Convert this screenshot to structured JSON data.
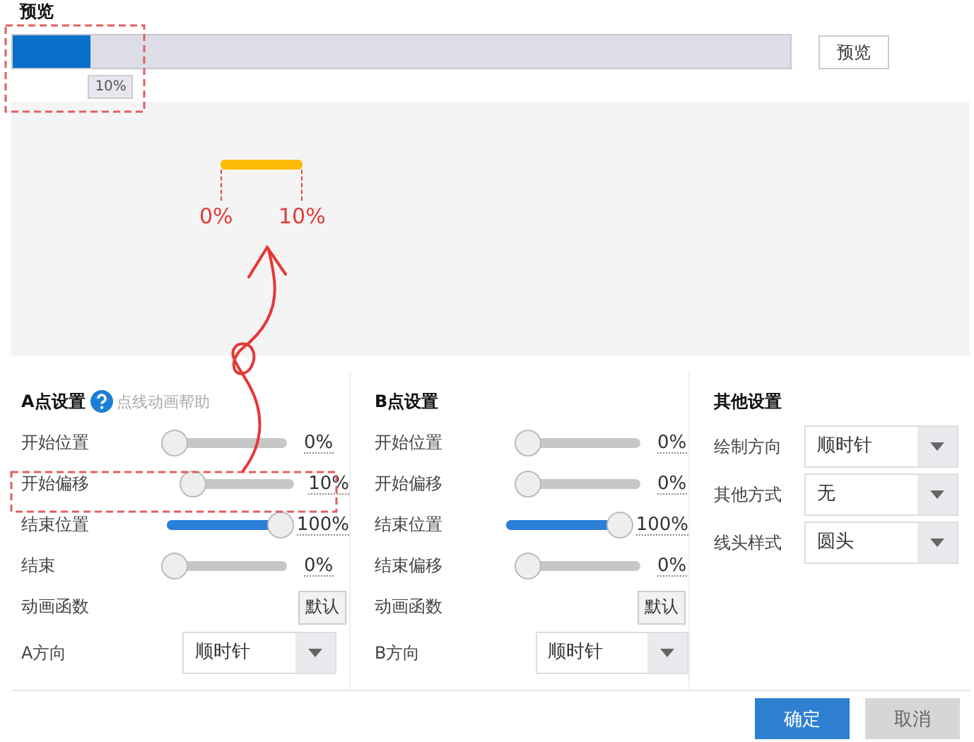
{
  "preview": {
    "title": "预览",
    "progress": {
      "level": 0.1,
      "tooltip": "10%"
    },
    "button": "预览"
  },
  "canvas": {
    "labels": [
      "0%",
      "10%"
    ]
  },
  "sections": [
    {
      "title": "A点设置",
      "help": "点线动画帮助",
      "rows": [
        {
          "kind": "slider",
          "label": "开始位置",
          "level": 0,
          "value": "0%"
        },
        {
          "kind": "slider",
          "label": "开始偏移",
          "level": 0.1,
          "value": "10%"
        },
        {
          "kind": "slider",
          "label": "结束位置",
          "level": 1,
          "value": "100%"
        },
        {
          "kind": "slider",
          "label": "结束",
          "level": 0,
          "value": "0%"
        },
        {
          "kind": "button",
          "label": "动画函数",
          "button": "默认"
        },
        {
          "kind": "select",
          "label": "A方向",
          "value": "顺时针"
        }
      ]
    },
    {
      "title": "B点设置",
      "rows": [
        {
          "kind": "slider",
          "label": "开始位置",
          "level": 0,
          "value": "0%"
        },
        {
          "kind": "slider",
          "label": "开始偏移",
          "level": 0,
          "value": "0%"
        },
        {
          "kind": "slider",
          "label": "结束位置",
          "level": 1,
          "value": "100%"
        },
        {
          "kind": "slider",
          "label": "结束偏移",
          "level": 0,
          "value": "0%"
        },
        {
          "kind": "button",
          "label": "动画函数",
          "button": "默认"
        },
        {
          "kind": "select",
          "label": "B方向",
          "value": "顺时针"
        }
      ]
    }
  ],
  "other": {
    "title": "其他设置",
    "rows": [
      {
        "label": "绘制方向",
        "value": "顺时针"
      },
      {
        "label": "其他方式",
        "value": "无"
      },
      {
        "label": "线头样式",
        "value": "圆头"
      }
    ]
  },
  "footer": {
    "confirm": "确定",
    "cancel": "取消"
  }
}
